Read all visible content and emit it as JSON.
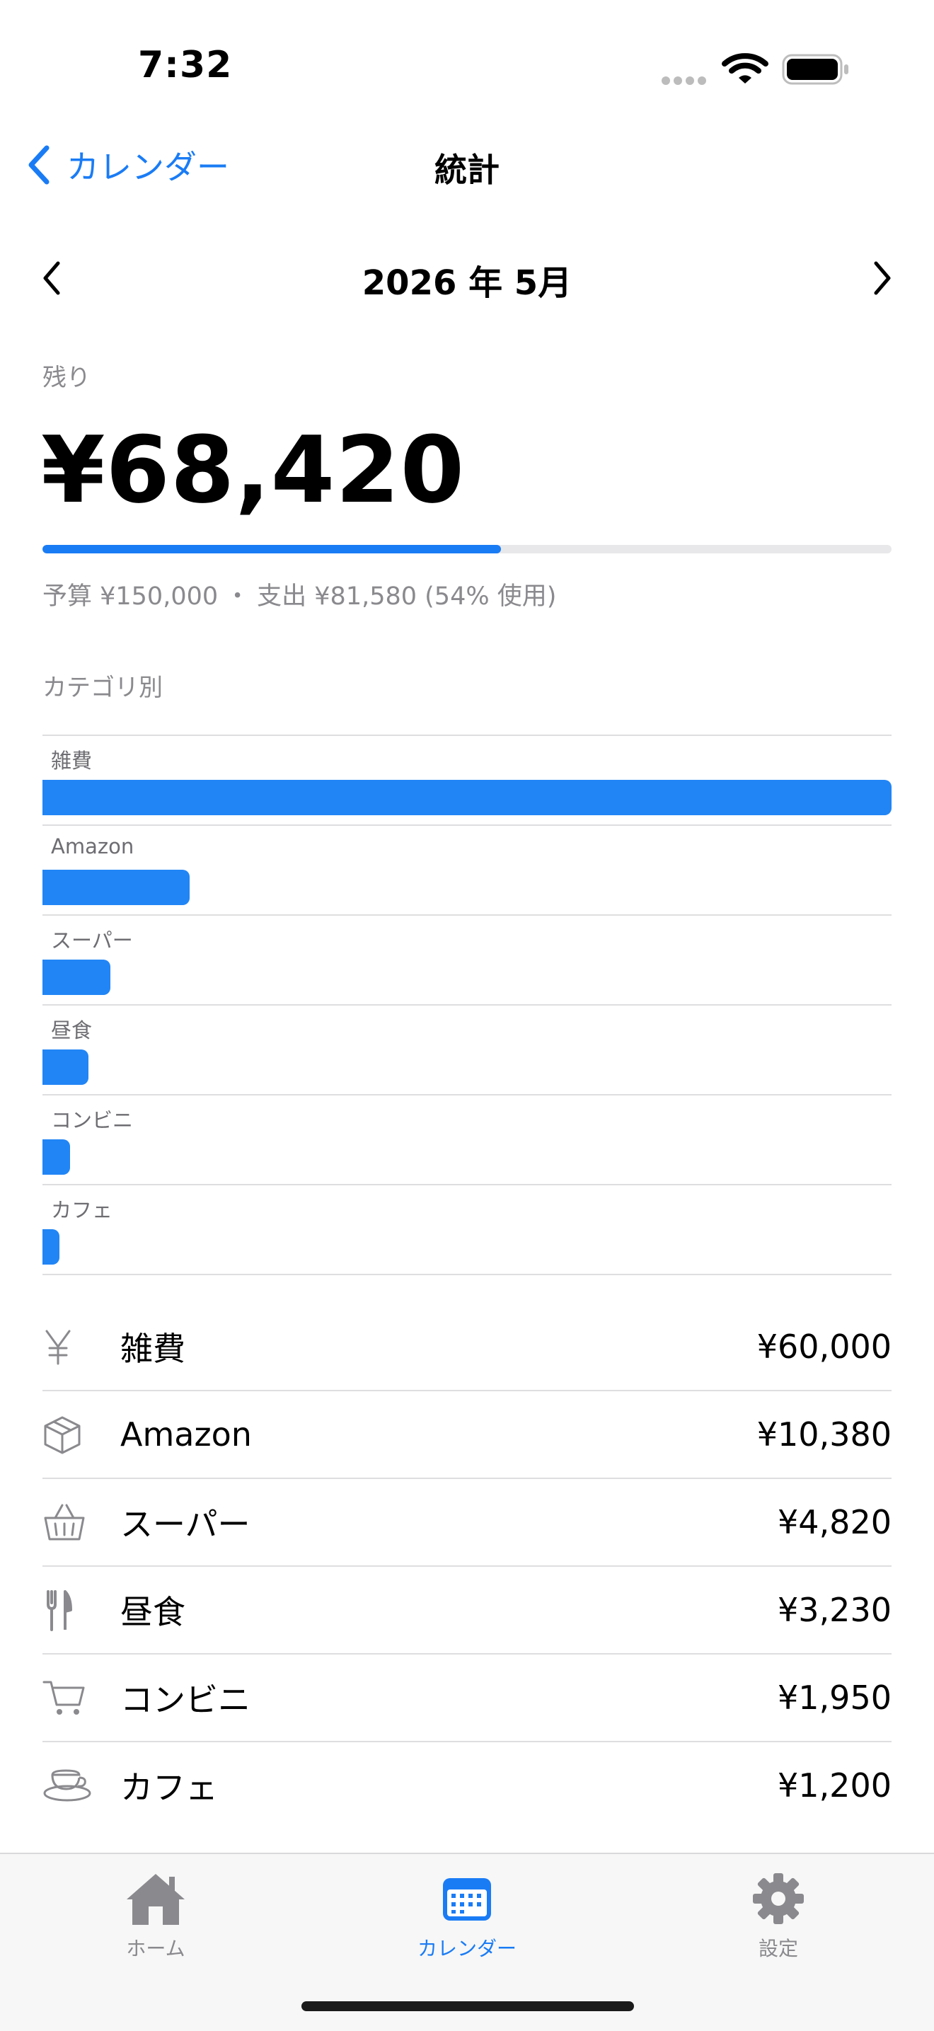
{
  "status_bar": {
    "time": "7:32"
  },
  "nav": {
    "back_label": "カレンダー",
    "title": "統計"
  },
  "month": {
    "label": "2026 年 5月"
  },
  "summary": {
    "remaining_label": "残り",
    "remaining_value": "¥68,420",
    "used_fraction": 0.54,
    "budget_text": "予算 ¥150,000",
    "separator": "・",
    "spent_text": "支出 ¥81,580 (54% 使用)"
  },
  "category_section_title": "カテゴリ別",
  "chart_data": {
    "type": "bar",
    "orientation": "horizontal",
    "categories": [
      "雑費",
      "Amazon",
      "スーパー",
      "昼食",
      "コンビニ",
      "カフェ"
    ],
    "values": [
      60000,
      10380,
      4820,
      3230,
      1950,
      1200
    ],
    "xlim": [
      0,
      60000
    ]
  },
  "categories": [
    {
      "icon": "yen-icon",
      "name": "雑費",
      "amount": "¥60,000"
    },
    {
      "icon": "box-icon",
      "name": "Amazon",
      "amount": "¥10,380"
    },
    {
      "icon": "basket-icon",
      "name": "スーパー",
      "amount": "¥4,820"
    },
    {
      "icon": "fork-knife-icon",
      "name": "昼食",
      "amount": "¥3,230"
    },
    {
      "icon": "cart-icon",
      "name": "コンビニ",
      "amount": "¥1,950"
    },
    {
      "icon": "cup-icon",
      "name": "カフェ",
      "amount": "¥1,200"
    }
  ],
  "tabs": [
    {
      "icon": "house-icon",
      "label": "ホーム",
      "active": false
    },
    {
      "icon": "calendar-icon",
      "label": "カレンダー",
      "active": true
    },
    {
      "icon": "gear-icon",
      "label": "設定",
      "active": false
    }
  ],
  "colors": {
    "accent": "#1a7cf5",
    "bar": "#2185f5",
    "secondary_text": "#8a8a8e"
  }
}
